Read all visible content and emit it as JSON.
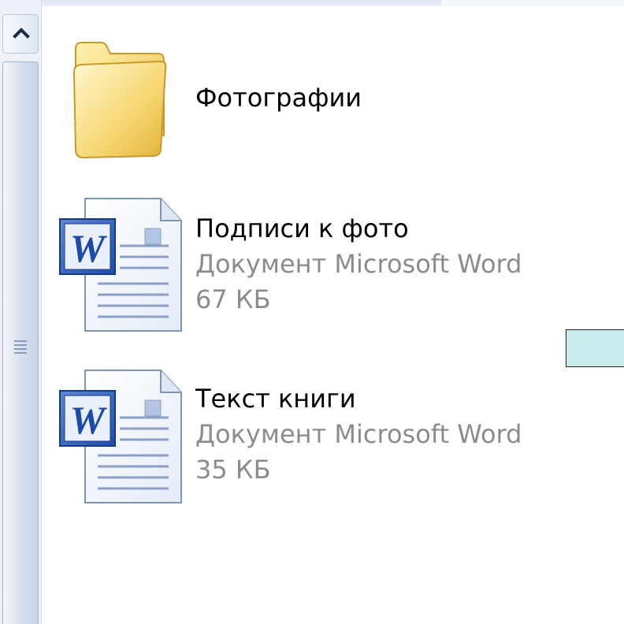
{
  "files": [
    {
      "name": "Фотографии",
      "type": "",
      "size": "",
      "icon": "folder-icon"
    },
    {
      "name": "Подписи к фото",
      "type": "Документ Microsoft Word",
      "size": "67 КБ",
      "icon": "word-document-icon"
    },
    {
      "name": "Текст книги",
      "type": "Документ Microsoft Word",
      "size": "35 КБ",
      "icon": "word-document-icon"
    }
  ],
  "colors": {
    "secondary_text": "#8c8c8c",
    "shape_fill": "#c9ecec",
    "scroll_thumb": "#c7d3e8"
  }
}
